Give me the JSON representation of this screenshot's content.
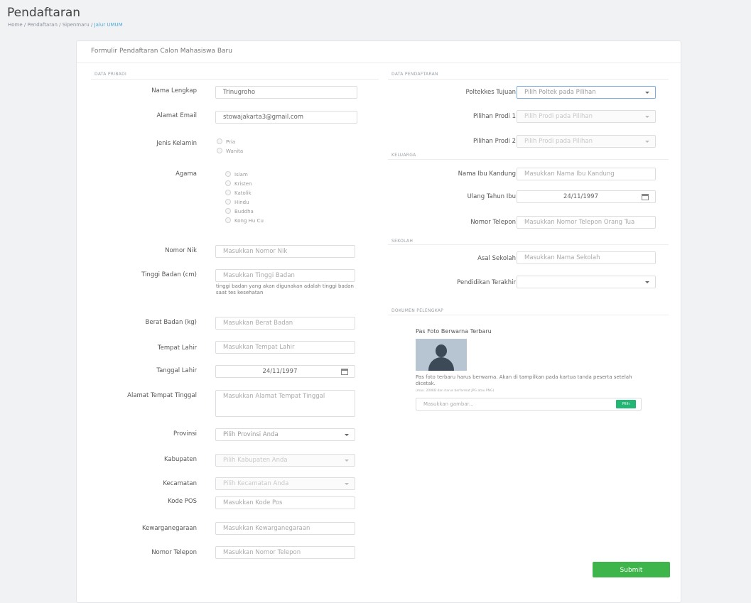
{
  "page": {
    "title": "Pendaftaran",
    "breadcrumb": [
      "Home",
      "Pendaftaran",
      "Sipenmaru",
      "Jalur UMUM"
    ],
    "breadcrumb_sep": " / "
  },
  "card": {
    "title": "Formulir Pendaftaran Calon Mahasiswa Baru"
  },
  "sections": {
    "pribadi": "DATA PRIBADI",
    "pendaftaran": "DATA PENDAFTARAN",
    "keluarga": "KELUARGA",
    "sekolah": "SEKOLAH",
    "dokumen": "DOKUMEN PELENGKAP"
  },
  "pribadi": {
    "nama": {
      "label": "Nama Lengkap",
      "value": "Trinugroho"
    },
    "email": {
      "label": "Alamat Email",
      "value": "stowajakarta3@gmail.com"
    },
    "gender": {
      "label": "Jenis Kelamin",
      "options": [
        "Pria",
        "Wanita"
      ]
    },
    "agama": {
      "label": "Agama",
      "options": [
        "Islam",
        "Kristen",
        "Katolik",
        "Hindu",
        "Buddha",
        "Kong Hu Cu"
      ]
    },
    "nik": {
      "label": "Nomor Nik",
      "placeholder": "Masukkan Nomor Nik"
    },
    "tinggi": {
      "label": "Tinggi Badan (cm)",
      "placeholder": "Masukkan Tinggi Badan",
      "hint": "tinggi badan yang akan digunakan adalah tinggi badan saat tes kesehatan"
    },
    "berat": {
      "label": "Berat Badan (kg)",
      "placeholder": "Masukkan Berat Badan"
    },
    "tempat_lahir": {
      "label": "Tempat Lahir",
      "placeholder": "Masukkan Tempat Lahir"
    },
    "tanggal_lahir": {
      "label": "Tanggal Lahir",
      "value": "24/11/1997"
    },
    "alamat": {
      "label": "Alamat Tempat Tinggal",
      "placeholder": "Masukkan Alamat Tempat Tinggal"
    },
    "provinsi": {
      "label": "Provinsi",
      "value": "Pilih Provinsi Anda"
    },
    "kabupaten": {
      "label": "Kabupaten",
      "value": "Pilih Kabupaten Anda"
    },
    "kecamatan": {
      "label": "Kecamatan",
      "value": "Pilih Kecamatan Anda"
    },
    "kode_pos": {
      "label": "Kode POS",
      "placeholder": "Masukkan Kode Pos"
    },
    "kewarganegaraan": {
      "label": "Kewarganegaraan",
      "placeholder": "Masukkan Kewarganegaraan"
    },
    "telepon": {
      "label": "Nomor Telepon",
      "placeholder": "Masukkan Nomor Telepon"
    }
  },
  "pendaftaran": {
    "poltekkes": {
      "label": "Poltekkes Tujuan",
      "value": "Pilih Poltek pada Pilihan"
    },
    "prodi1": {
      "label": "Pilihan Prodi 1",
      "value": "Pilih Prodi pada Pilihan"
    },
    "prodi2": {
      "label": "Pilihan Prodi 2",
      "value": "Pilih Prodi pada Pilihan"
    }
  },
  "keluarga": {
    "ibu": {
      "label": "Nama Ibu Kandung",
      "placeholder": "Masukkan Nama Ibu Kandung"
    },
    "ultah_ibu": {
      "label": "Ulang Tahun Ibu",
      "value": "24/11/1997"
    },
    "telepon": {
      "label": "Nomor Telepon",
      "placeholder": "Masukkan Nomor Telepon Orang Tua"
    }
  },
  "sekolah": {
    "asal": {
      "label": "Asal Sekolah",
      "placeholder": "Masukkan Nama Sekolah"
    },
    "pendidikan": {
      "label": "Pendidikan Terakhir",
      "value": ""
    }
  },
  "dokumen": {
    "foto_label": "Pas Foto Berwarna Terbaru",
    "foto_hint": "Pas foto terbaru harus berwarna. Akan di tampilkan pada kartua tanda peserta setelah dicetak.",
    "foto_small": "(max. 200KB dan harus berformat JPG atau PNG)",
    "file_placeholder": "Masukkan gambar...",
    "browse_label": "Pilih"
  },
  "submit_label": "Submit"
}
